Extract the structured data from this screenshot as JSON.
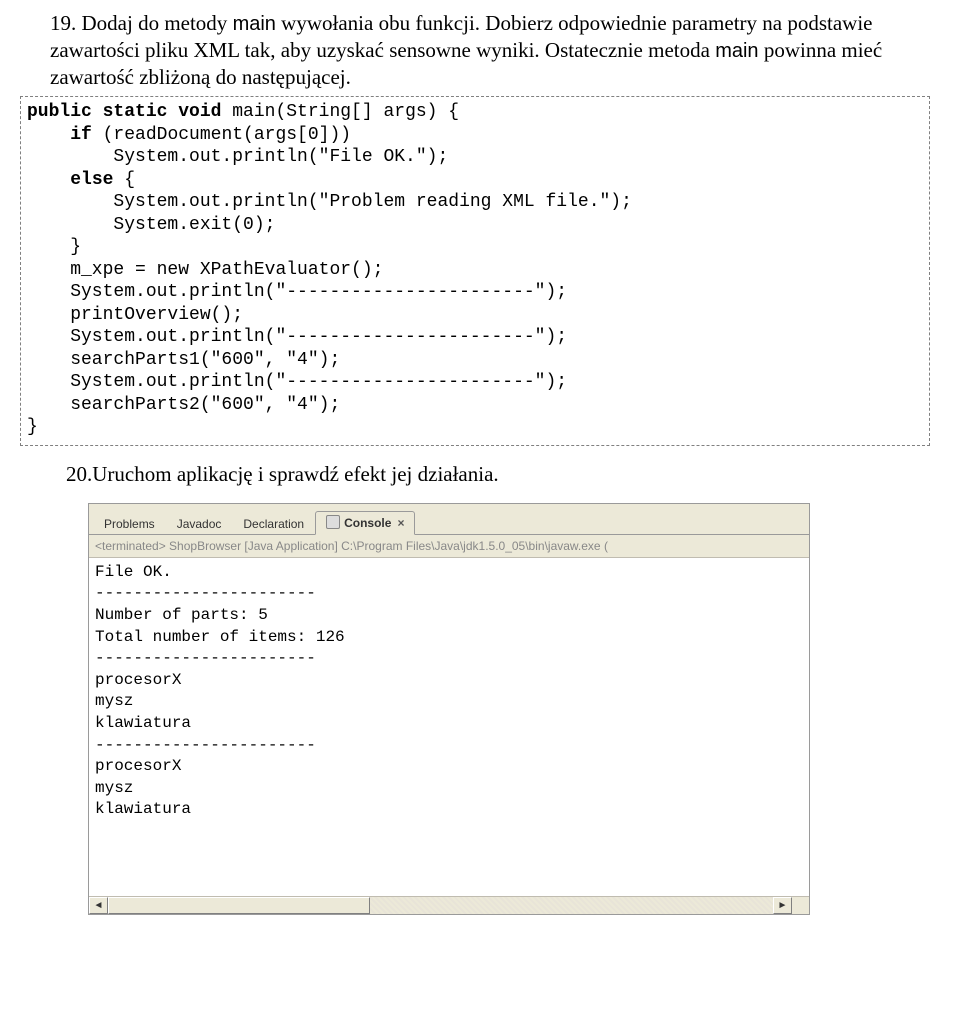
{
  "step19": {
    "text": "Dodaj do metody ",
    "code1": "main",
    "text2": " wywołania obu funkcji. Dobierz odpowiednie parametry na podstawie zawartości pliku XML tak, aby uzyskać sensowne wyniki. Ostatecznie metoda ",
    "code2": "main",
    "text3": " powinna mieć zawartość zbliżoną do następującej."
  },
  "codeblock": {
    "l1a": "public static void",
    "l1b": " main(String[] args) {",
    "l2a": "    ",
    "l2b": "if",
    "l2c": " (readDocument(args[0]))",
    "l3": "        System.out.println(\"File OK.\");",
    "l4a": "    ",
    "l4b": "else",
    "l4c": " {",
    "l5": "        System.out.println(\"Problem reading XML file.\");",
    "l6": "        System.exit(0);",
    "l7": "    }",
    "l8": "    m_xpe = new XPathEvaluator();",
    "l9": "    System.out.println(\"-----------------------\");",
    "l10": "    printOverview();",
    "l11": "    System.out.println(\"-----------------------\");",
    "l12": "    searchParts1(\"600\", \"4\");",
    "l13": "    System.out.println(\"-----------------------\");",
    "l14": "    searchParts2(\"600\", \"4\");",
    "l15": "}"
  },
  "step20": "Uruchom aplikację i sprawdź efekt jej działania.",
  "ide": {
    "tabs": {
      "problems": "Problems",
      "javadoc": "Javadoc",
      "declaration": "Declaration",
      "console": "Console"
    },
    "terminated": "<terminated> ShopBrowser [Java Application] C:\\Program Files\\Java\\jdk1.5.0_05\\bin\\javaw.exe (",
    "output": "File OK.\n-----------------------\nNumber of parts: 5\nTotal number of items: 126\n-----------------------\nprocesorX\nmysz\nklawiatura\n-----------------------\nprocesorX\nmysz\nklawiatura"
  }
}
